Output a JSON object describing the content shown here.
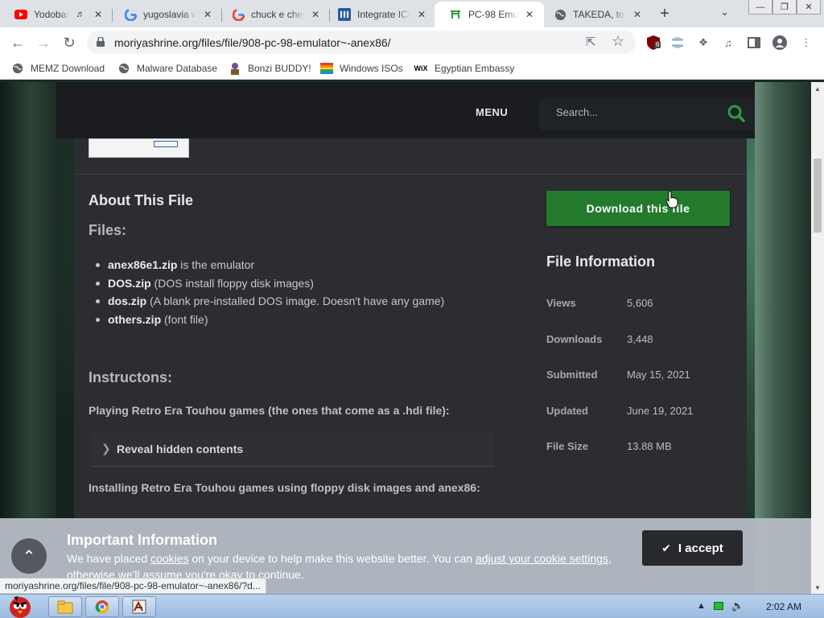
{
  "browser": {
    "tabs": [
      {
        "title": "Yodobashi",
        "icon": "youtube-icon",
        "muted_icon": "speaker-icon"
      },
      {
        "title": "yugoslavia w",
        "icon": "google-icon"
      },
      {
        "title": "chuck e chee",
        "icon": "google-icon"
      },
      {
        "title": "Integrate ICH",
        "icon": "integrate-icon"
      },
      {
        "title": "PC-98 Emula",
        "icon": "site-icon",
        "active": true
      },
      {
        "title": "TAKEDA, tos",
        "icon": "globe-icon"
      }
    ],
    "new_tab": "+",
    "url": "moriyashrine.org/files/file/908-pc-98-emulator~-anex86/",
    "extension_badge": "6",
    "bookmarks": [
      {
        "label": "MEMZ Download",
        "icon": "globe-icon"
      },
      {
        "label": "Malware Database",
        "icon": "globe-icon"
      },
      {
        "label": "Bonzi BUDDY!",
        "icon": "bonzi-icon"
      },
      {
        "label": "Windows ISOs",
        "icon": "windows-flag-icon"
      },
      {
        "label": "Egyptian Embassy",
        "icon": "wix-icon"
      }
    ],
    "wix_label": "WiX"
  },
  "site": {
    "menu_label": "MENU",
    "search_placeholder": "Search..."
  },
  "file": {
    "about_heading": "About This File",
    "files_heading": "Files:",
    "files": [
      {
        "name": "anex86e1.zip",
        "desc": " is the emulator"
      },
      {
        "name": "DOS.zip",
        "desc": " (DOS install floppy disk images)"
      },
      {
        "name": "dos.zip",
        "desc": " (A blank pre-installed DOS image. Doesn't have any game)"
      },
      {
        "name": "others.zip",
        "desc": " (font file)"
      }
    ],
    "instructions_heading": "Instructons:",
    "para1": "Playing Retro Era Touhou games (the ones that come as a .hdi file):",
    "spoiler_label": "Reveal hidden contents",
    "para2": "Installing Retro Era Touhou games using floppy disk images and anex86:",
    "download_label": "Download this file",
    "info_heading": "File Information",
    "info": [
      {
        "key": "Views",
        "value": "5,606"
      },
      {
        "key": "Downloads",
        "value": "3,448"
      },
      {
        "key": "Submitted",
        "value": "May 15, 2021"
      },
      {
        "key": "Updated",
        "value": "June 19, 2021"
      },
      {
        "key": "File Size",
        "value": "13.88 MB"
      }
    ]
  },
  "cookie": {
    "heading": "Important Information",
    "text_a": "We have placed ",
    "link_cookies": "cookies",
    "text_b": " on your device to help make this website better. You can ",
    "link_settings": "adjust your cookie settings",
    "text_c": ", otherwise we'll assume you're okay to continue.",
    "accept_label": "I accept"
  },
  "status_url": "moriyashrine.org/files/file/908-pc-98-emulator~-anex86/?d...",
  "taskbar": {
    "clock": "2:02 AM"
  },
  "colors": {
    "download_green": "#237a2c",
    "search_green": "#2e9e3a",
    "panel_bg": "#2b2d31"
  }
}
